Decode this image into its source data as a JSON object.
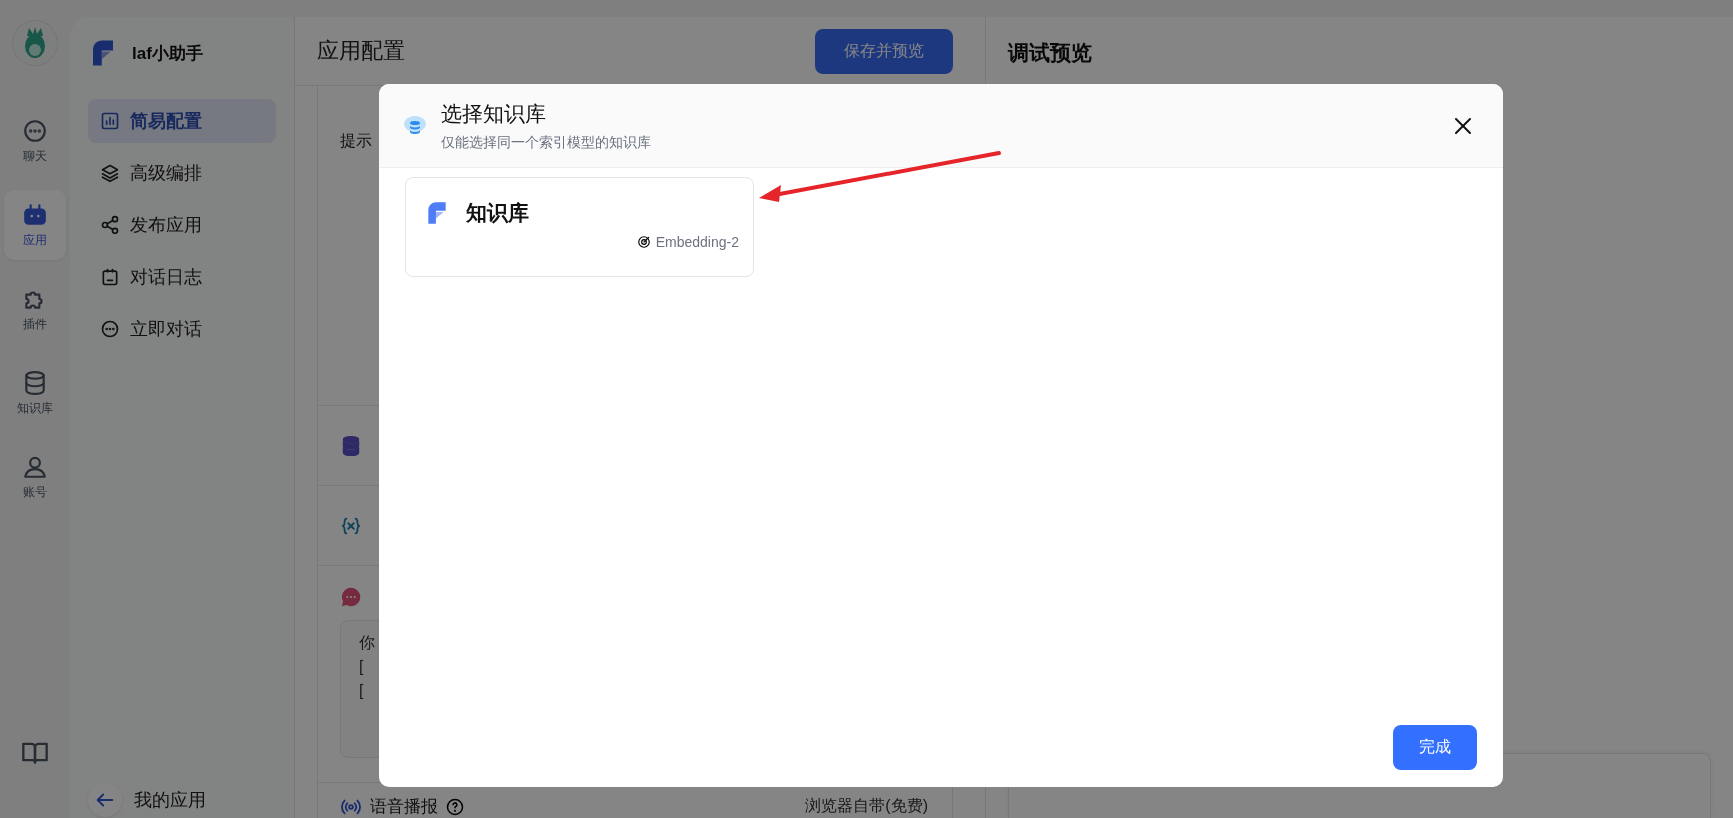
{
  "nav_rail": {
    "items": [
      {
        "label": "聊天",
        "selected": false
      },
      {
        "label": "应用",
        "selected": true
      },
      {
        "label": "插件",
        "selected": false
      },
      {
        "label": "知识库",
        "selected": false
      },
      {
        "label": "账号",
        "selected": false
      }
    ]
  },
  "sidebar": {
    "app_name": "laf小助手",
    "items": [
      {
        "label": "简易配置",
        "selected": true
      },
      {
        "label": "高级编排",
        "selected": false
      },
      {
        "label": "发布应用",
        "selected": false
      },
      {
        "label": "对话日志",
        "selected": false
      },
      {
        "label": "立即对话",
        "selected": false
      }
    ],
    "back_label": "我的应用"
  },
  "config_panel": {
    "title": "应用配置",
    "save_button": "保存并预览",
    "prompt_label": "提示",
    "opening_lines": [
      "你",
      "[",
      "["
    ],
    "voice_label": "语音播报",
    "voice_value": "浏览器自带(免费)"
  },
  "preview_panel": {
    "title": "调试预览"
  },
  "modal": {
    "title": "选择知识库",
    "subtitle": "仅能选择同一个索引模型的知识库",
    "datasets": [
      {
        "name": "知识库",
        "model": "Embedding-2"
      }
    ],
    "done_button": "完成"
  }
}
